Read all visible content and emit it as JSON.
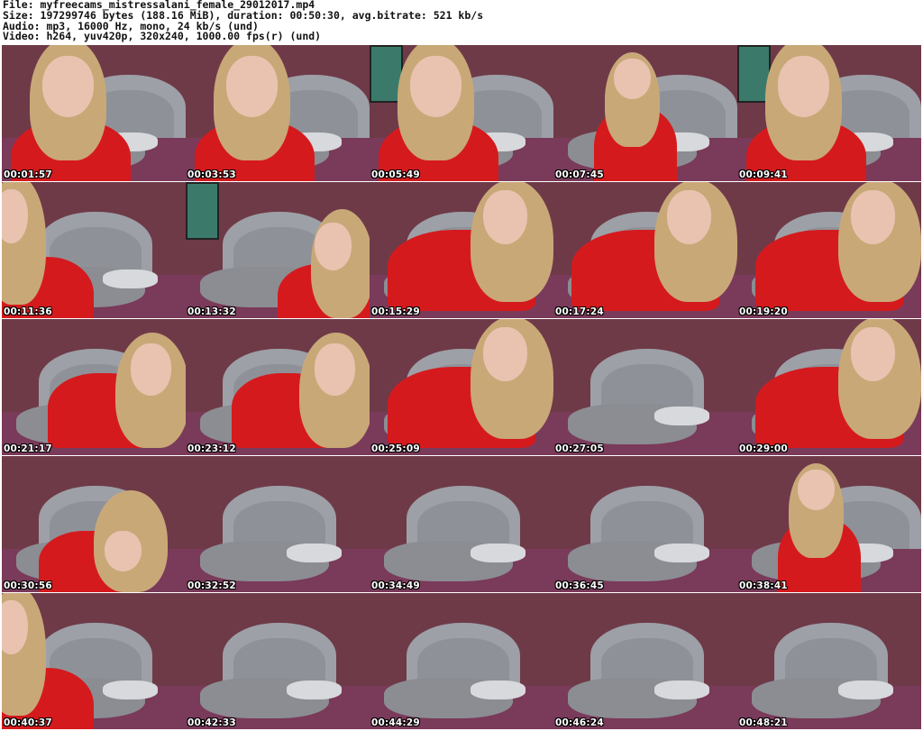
{
  "header": {
    "file": "File: myfreecams_mistressalani_female_29012017.mp4",
    "size": "Size: 197299746 bytes (188.16 MiB), duration: 00:50:30, avg.bitrate: 521 kb/s",
    "audio": "Audio: mp3, 16000 Hz, mono, 24 kb/s (und)",
    "video": "Video: h264, yuv420p, 320x240, 1000.00 fps(r) (und)"
  },
  "thumbnails": [
    {
      "time": "00:01:57",
      "scene": "close-face"
    },
    {
      "time": "00:03:53",
      "scene": "close-face"
    },
    {
      "time": "00:05:49",
      "scene": "close-face"
    },
    {
      "time": "00:07:45",
      "scene": "sit-mid"
    },
    {
      "time": "00:09:41",
      "scene": "close-face"
    },
    {
      "time": "00:11:36",
      "scene": "edge-left"
    },
    {
      "time": "00:13:32",
      "scene": "lean-right"
    },
    {
      "time": "00:15:29",
      "scene": "lying"
    },
    {
      "time": "00:17:24",
      "scene": "lying"
    },
    {
      "time": "00:19:20",
      "scene": "lying"
    },
    {
      "time": "00:21:17",
      "scene": "lying-right"
    },
    {
      "time": "00:23:12",
      "scene": "lying-right"
    },
    {
      "time": "00:25:09",
      "scene": "lying"
    },
    {
      "time": "00:27:05",
      "scene": "empty-bed"
    },
    {
      "time": "00:29:00",
      "scene": "lying"
    },
    {
      "time": "00:30:56",
      "scene": "head-down"
    },
    {
      "time": "00:32:52",
      "scene": "empty-bed"
    },
    {
      "time": "00:34:49",
      "scene": "empty-bed"
    },
    {
      "time": "00:36:45",
      "scene": "empty-bed"
    },
    {
      "time": "00:38:41",
      "scene": "sit-mid"
    },
    {
      "time": "00:40:37",
      "scene": "edge-left"
    },
    {
      "time": "00:42:33",
      "scene": "empty-bed"
    },
    {
      "time": "00:44:29",
      "scene": "empty-bed"
    },
    {
      "time": "00:46:24",
      "scene": "empty-bed"
    },
    {
      "time": "00:48:21",
      "scene": "empty-bed"
    }
  ],
  "colors": {
    "wall": "#6e3a48",
    "headboard": "#9da0a6",
    "bedding": "#7a3a5a",
    "blanket": "#8b8d92",
    "hair": "#c9a878",
    "shirt": "#d51a1d",
    "skin": "#e9c3b0"
  }
}
